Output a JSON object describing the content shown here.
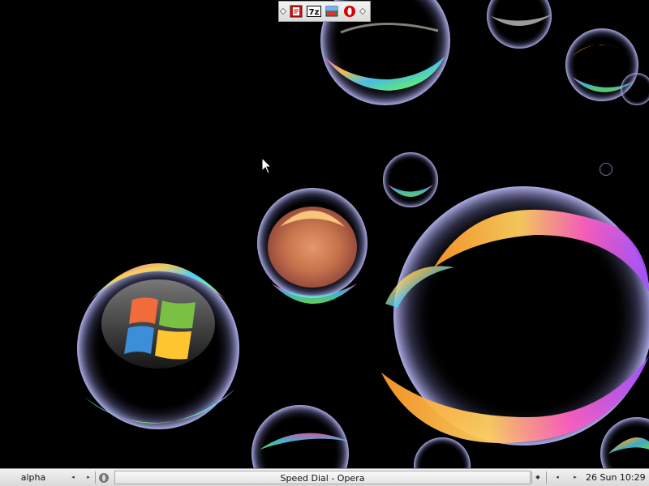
{
  "desktop": {
    "wallpaper": "soap-bubbles",
    "background_color": "#000000"
  },
  "launcher": {
    "items": [
      {
        "icon": "pdf-reader-icon"
      },
      {
        "icon": "7zip-icon",
        "label": "7z"
      },
      {
        "icon": "image-viewer-icon"
      },
      {
        "icon": "opera-icon"
      }
    ]
  },
  "taskbar": {
    "desktop_name": "alpha",
    "active_task": "Speed Dial - Opera",
    "clock": "26 Sun 10:29",
    "colors": {
      "bar": "#e4e4e4",
      "border": "#8e8e8e"
    }
  }
}
